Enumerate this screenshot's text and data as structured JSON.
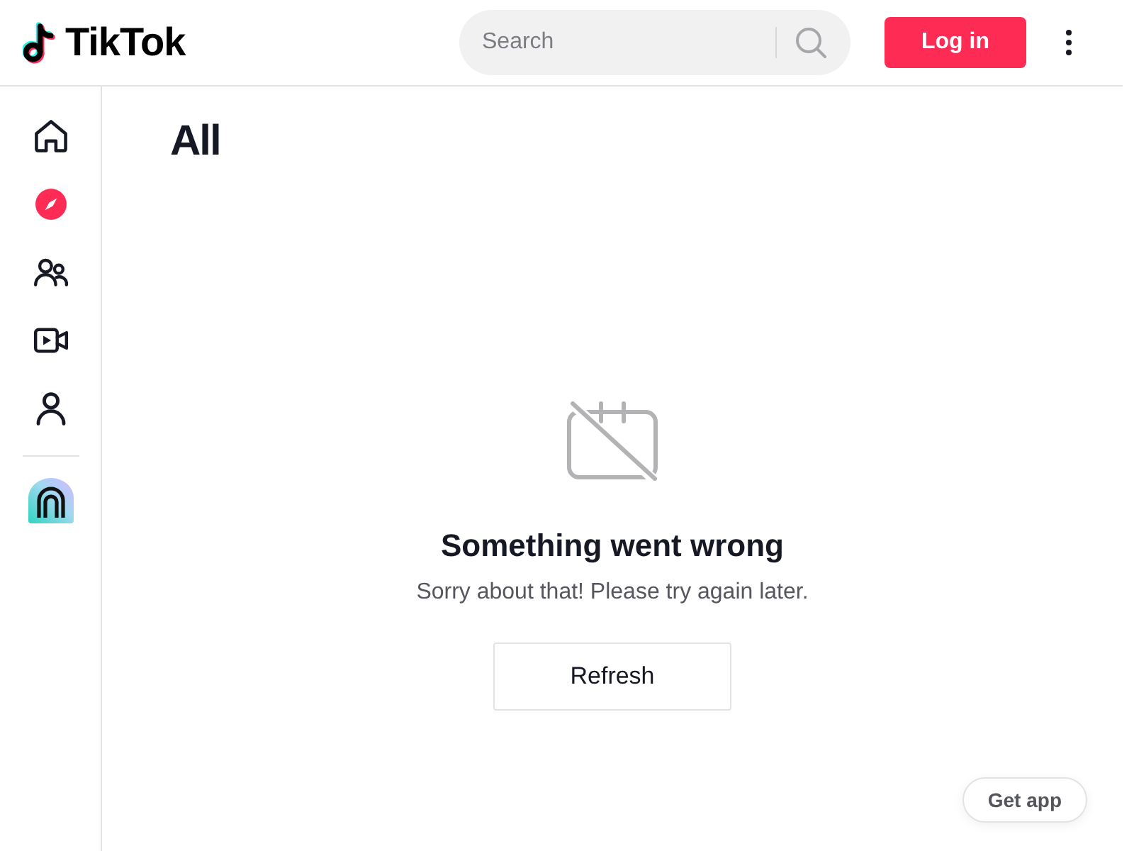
{
  "header": {
    "logo": "TikTok",
    "search": {
      "placeholder": "Search"
    },
    "login_button": "Log in"
  },
  "sidebar": {
    "items": [
      {
        "kind": "home",
        "selected": false
      },
      {
        "kind": "compass",
        "selected": true
      },
      {
        "kind": "people",
        "selected": false
      },
      {
        "kind": "video",
        "selected": false
      },
      {
        "kind": "person",
        "selected": false
      }
    ]
  },
  "main": {
    "title": "All",
    "error": {
      "title": "Something went wrong",
      "message": "Sorry about that! Please try again later.",
      "button": "Refresh"
    }
  },
  "get_app_button": "Get app"
}
